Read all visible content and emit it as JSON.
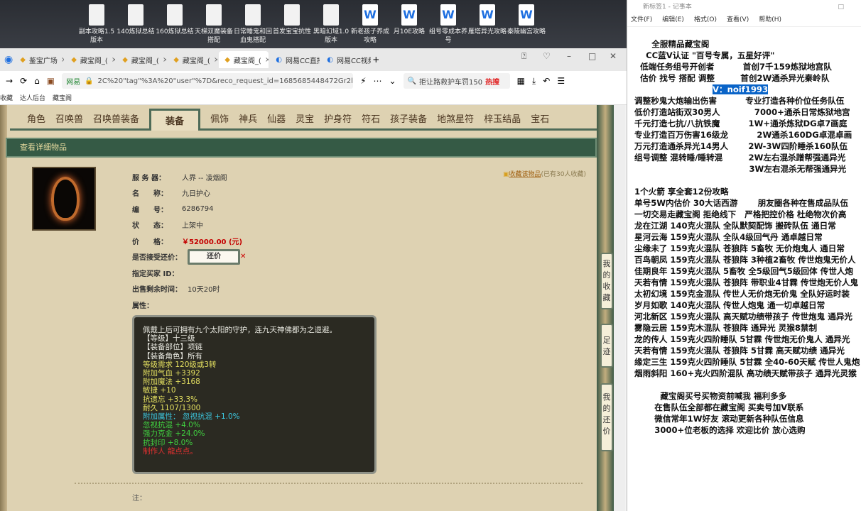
{
  "desktop": {
    "icons": [
      {
        "label": "副本攻略1.5版本",
        "type": "txt"
      },
      {
        "label": "140炼狱总结",
        "type": "txt"
      },
      {
        "label": "160炼狱总结",
        "type": "txt"
      },
      {
        "label": "天梯双魔装备搭配",
        "type": "txt"
      },
      {
        "label": "日常睡鬼和回血鬼搭配",
        "type": "txt"
      },
      {
        "label": "首发宝宝抗性",
        "type": "txt"
      },
      {
        "label": "黑暗幻域1.0版本",
        "type": "txt"
      },
      {
        "label": "新老孩子养成攻略",
        "type": "word"
      },
      {
        "label": "月10E攻略",
        "type": "word"
      },
      {
        "label": "组号零成本养号",
        "type": "word"
      },
      {
        "label": "雁塔异光攻略",
        "type": "word"
      },
      {
        "label": "秦陵幽宫攻略",
        "type": "word"
      }
    ]
  },
  "browser": {
    "tabs": [
      {
        "label": "鉴宝广场"
      },
      {
        "label": "藏宝阁_("
      },
      {
        "label": "藏宝阁_("
      },
      {
        "label": "藏宝阁_("
      },
      {
        "label": "藏宝阁_(",
        "active": true
      },
      {
        "label": "网易CC直播"
      },
      {
        "label": "网易CC视频"
      }
    ],
    "new_tab": "+",
    "url_site": "网易",
    "url": "2C%20\"tag\"%3A%20\"user\"%7D&reco_request_id=1685685448472Gr2lo",
    "search_text": "拒让路救护车罚150",
    "search_badge": "热搜",
    "bookmarks": [
      "收藏",
      "达人后台",
      "藏宝阁"
    ]
  },
  "game": {
    "tabs": [
      "角色",
      "召唤兽",
      "召唤兽装备",
      "装备",
      "佩饰",
      "神兵",
      "仙器",
      "灵宝",
      "护身符",
      "符石",
      "孩子装备",
      "地煞星符",
      "梓玉结晶",
      "宝石"
    ],
    "selected_tab": "装备",
    "header": "查看详细物品",
    "fields": [
      {
        "label": "服 务 器：",
        "value": "人界 -- 凌烟阁"
      },
      {
        "label": "名　　称：",
        "value": "九日护心"
      },
      {
        "label": "编　　号：",
        "value": "6286794"
      },
      {
        "label": "状　　态：",
        "value": "上架中"
      },
      {
        "label": "价　　格：",
        "value": "￥52000.00 (元)"
      }
    ],
    "haggle_label": "是否接受还价：",
    "haggle_button": "还价",
    "buyer_label": "指定买家 ID：",
    "time_label": "出售剩余时间：",
    "time_value": "10天20时",
    "attr_label": "属性：",
    "fav_link": "收藏该物品",
    "fav_count": "(已有30人收藏)",
    "tooltip": [
      {
        "text": "佩戴上后可拥有九个太阳的守护，连九天神佛都为之退避。",
        "color": "#e8e8e0"
      },
      {
        "text": "【等级】十三级",
        "color": "#e8e8e0"
      },
      {
        "text": "【装备部位】项链",
        "color": "#e8e8e0"
      },
      {
        "text": "【装备角色】所有",
        "color": "#e8e8e0"
      },
      {
        "text": "等级需求 120级或3转",
        "color": "#e4e060"
      },
      {
        "text": "附加气血 +3392",
        "color": "#e4e060"
      },
      {
        "text": "附加魔法 +3168",
        "color": "#e4e060"
      },
      {
        "text": "敏捷 +10",
        "color": "#e4e060"
      },
      {
        "text": "抗遗忘 +33.3%",
        "color": "#e4e060"
      },
      {
        "text": "耐久 1107/1300",
        "color": "#e4e060"
      },
      {
        "text": "附加属性： 忽视抗混 +1.0%",
        "color": "#3cc8e0"
      },
      {
        "text": "忽视抗混 +4.0%",
        "color": "#40d040"
      },
      {
        "text": "强力克金 +24.0%",
        "color": "#40d040"
      },
      {
        "text": "抗封印 +8.0%",
        "color": "#40d040"
      },
      {
        "text": "制作人 龍点点。",
        "color": "#e03030"
      }
    ],
    "note_label": "注：",
    "side_buttons": [
      "我的收藏",
      "足迹",
      "我的还价"
    ]
  },
  "notepad": {
    "title": "新标签1 - 记事本",
    "menu": [
      "文件(F)",
      "编辑(E)",
      "格式(O)",
      "查看(V)",
      "帮助(H)"
    ],
    "lines_top": "      全服精品藏宝阁\n    CC蓝V认证 \"百号专属，五星好评\"\n  低端任务组号开创者          首创7千159炼狱地宫队\n  估价 找号 搭配 调整         首创2W通杀异光秦岭队",
    "contact": "V：noif1993",
    "lines_mid": "\n调整秒鬼大炮输出伤害          专业打造各种价位任务队伍\n低价打造站街双30男人            7000+通杀日常炼狱地宫\n千元打造七抗/八抗铁魔          1W+通杀炼狱DG卓7画庭\n专业打造百万伤害16级龙          2W通杀160DG卓混卓画\n万元打造通杀异光14男人       2W-3W四阶睡杀160队伍\n组号调整 混转睡/睡转混         2W左右混杀蹭帮强通异光\n                                        3W左右混杀无帮强通异光\n\n1个火箭 享全套12份攻略\n单号5W内估价 30大话西游       朋友圈各种在售成品队伍\n一切交易走藏宝阁 拒绝线下   严格把控价格 杜绝物次价高\n",
    "lines_list": "龙在江湖 140克火混队 全队默契配饰 搬砖队伍 通日常\n星河云海 159克火混队 全队4级回气丹 通卓越日常\n尘缘未了 159克火混队 苍狼阵 5畜牧 无价炮鬼人 通日常\n百鸟朝凤 159克火混队 苍狼阵 3种植2畜牧 传世炮鬼无价人\n佳期良年 159克火混队 5畜牧 全5级回气5级回体 传世人炮\n天若有情 159克火混队 苍狼阵 带职业4甘霖 传世炮无价人鬼\n太初幻境 159克金混队 传世人无价炮无价鬼 全队好运时装\n岁月如歌 140克火混队 传世人炮鬼 通一切卓越日常\n河北新区 159克火混队 高天赋功绩带孩子 传世炮鬼 通异光\n雾隐云居 159克木混队 苍狼阵 通异光 灵猴8禁制\n龙的传人 159克火四阶睡队 5甘霖 传世炮无价鬼人 通异光\n天若有情 159克火混队 苍狼阵 5甘霖 高天赋功绩 通异光\n缘定三生 159克火四阶睡队 5甘霖 全40-60天赋 传世人鬼炮\n烟雨斜阳 160+克火四阶混队 高功绩天赋带孩子 通异光灵猴\n\n         藏宝阁买号买物资前喊我 福利多多\n       在售队伍全部都在藏宝阁 买卖号加V联系\n       微信常年1W好友 滚动更新各种队伍信息\n       3000+位老板的选择 欢迎比价 放心选购"
  }
}
